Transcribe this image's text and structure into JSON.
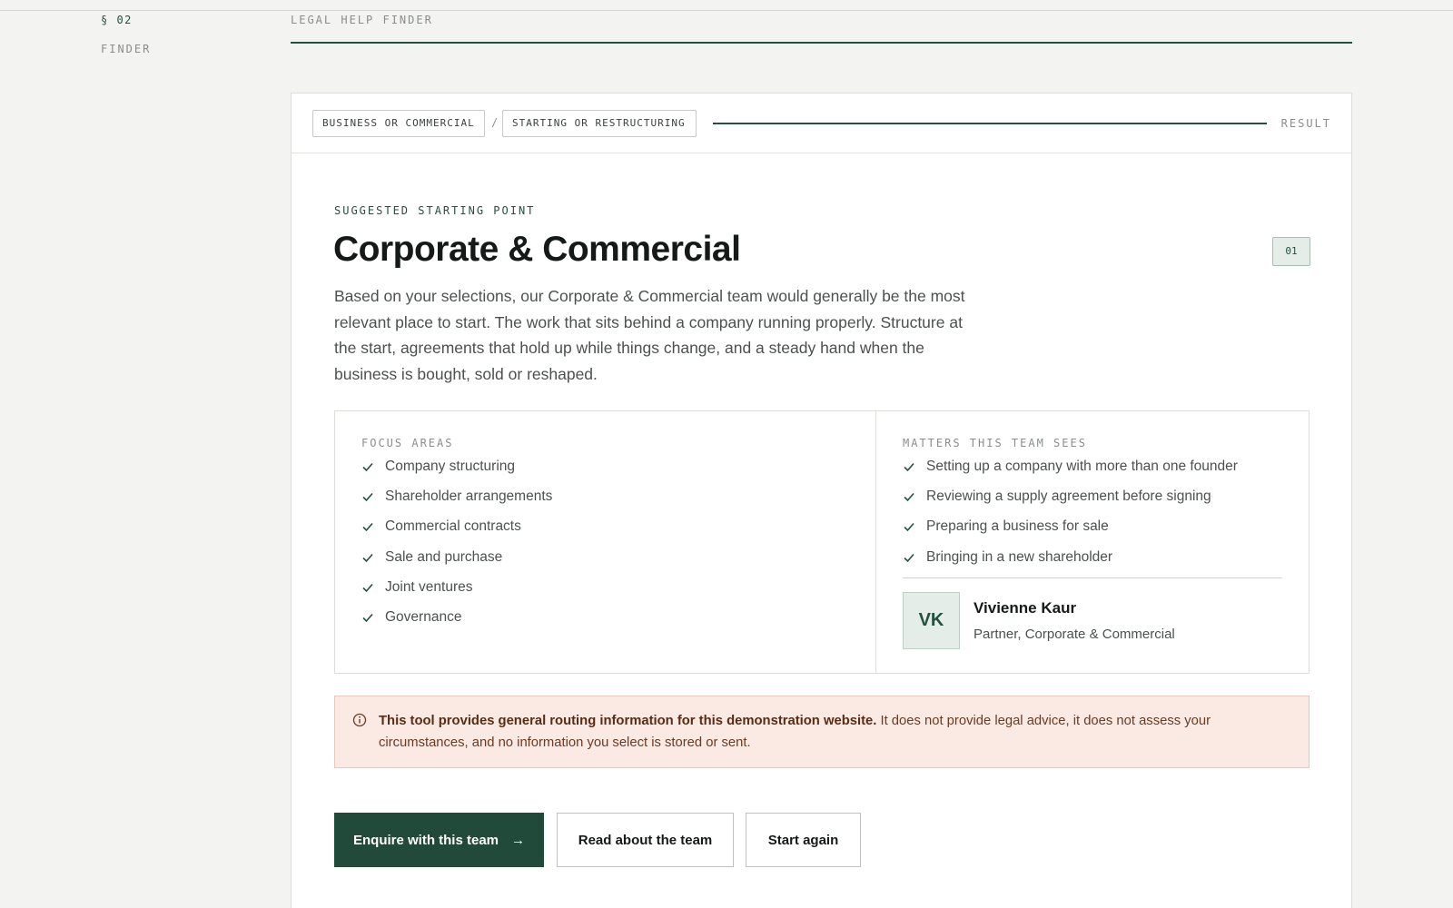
{
  "section": {
    "number": "§ 02",
    "label": "FINDER"
  },
  "header": {
    "title": "LEGAL HELP FINDER"
  },
  "breadcrumb": {
    "steps": [
      "BUSINESS OR COMMERCIAL",
      "STARTING OR RESTRUCTURING"
    ],
    "separator": "/",
    "result_label": "RESULT"
  },
  "result": {
    "eyebrow": "SUGGESTED STARTING POINT",
    "title": "Corporate & Commercial",
    "index": "01",
    "description": "Based on your selections, our Corporate & Commercial team would generally be the most relevant place to start. The work that sits behind a company running properly. Structure at the start, agreements that hold up while things change, and a steady hand when the business is bought, sold or reshaped."
  },
  "focus_areas": {
    "heading": "FOCUS AREAS",
    "items": [
      "Company structuring",
      "Shareholder arrangements",
      "Commercial contracts",
      "Sale and purchase",
      "Joint ventures",
      "Governance"
    ]
  },
  "matters": {
    "heading": "MATTERS THIS TEAM SEES",
    "items": [
      "Setting up a company with more than one founder",
      "Reviewing a supply agreement before signing",
      "Preparing a business for sale",
      "Bringing in a new shareholder"
    ]
  },
  "contact": {
    "initials": "VK",
    "name": "Vivienne Kaur",
    "role": "Partner, Corporate & Commercial"
  },
  "notice": {
    "bold": "This tool provides general routing information for this demonstration website.",
    "text": " It does not provide legal advice, it does not assess your circumstances, and no information you select is stored or sent."
  },
  "actions": {
    "enquire": "Enquire with this team",
    "enquire_arrow": "→",
    "read": "Read about the team",
    "restart": "Start again"
  },
  "colors": {
    "accent": "#214a3b",
    "notice_bg": "#faeae3",
    "background": "#f3f3f1"
  }
}
